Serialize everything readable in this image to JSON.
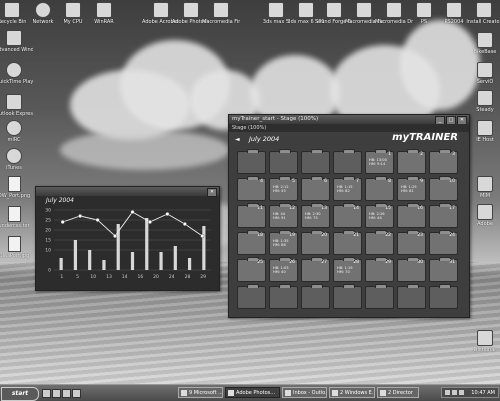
{
  "desktop": {
    "top_icons": [
      {
        "label": "Recycle Bin",
        "icon": "recycle-bin-icon"
      },
      {
        "label": "Network",
        "icon": "network-icon"
      },
      {
        "label": "My CPU",
        "icon": "computer-icon"
      },
      {
        "label": "WinRAR",
        "icon": "winrar-icon"
      },
      {
        "label": "Adobe Acrobat 4.0",
        "icon": "acrobat-icon"
      },
      {
        "label": "Adobe Photoshop",
        "icon": "photoshop-icon"
      },
      {
        "label": "Macromedia Fireworks 4.0",
        "icon": "fireworks-icon"
      },
      {
        "label": "3ds max 5",
        "icon": "3dsmax-icon"
      },
      {
        "label": "3ds max 6 SP1",
        "icon": "3dsmax-icon"
      },
      {
        "label": "Sound Forge 6.0",
        "icon": "soundforge-icon"
      },
      {
        "label": "Macromedia Flash MX",
        "icon": "flash-icon"
      },
      {
        "label": "Macromedia Dreamwea...",
        "icon": "dreamweaver-icon"
      },
      {
        "label": "PS",
        "icon": "app-icon"
      },
      {
        "label": "PS2004",
        "icon": "app-icon"
      },
      {
        "label": "Install Creator",
        "icon": "installer-icon"
      }
    ],
    "left_icons": [
      {
        "label": "Advanced WindowsM...",
        "icon": "app-icon"
      },
      {
        "label": "QuickTime Player",
        "icon": "quicktime-icon"
      },
      {
        "label": "Outlook Express",
        "icon": "outlook-icon"
      },
      {
        "label": "mIRC",
        "icon": "mirc-icon"
      },
      {
        "label": "iTunes",
        "icon": "itunes-icon"
      },
      {
        "label": "DW_Port.png",
        "icon": "image-file-icon"
      },
      {
        "label": "undercss.txt",
        "icon": "text-file-icon"
      },
      {
        "label": "DW_Port.jpg",
        "icon": "image-file-icon"
      }
    ],
    "right_icons": [
      {
        "label": "BikeBase",
        "icon": "app-icon"
      },
      {
        "label": "ServiO",
        "icon": "app-icon"
      },
      {
        "label": "Steady",
        "icon": "app-icon"
      },
      {
        "label": "IE Host",
        "icon": "ie-icon"
      },
      {
        "label": "MIM",
        "icon": "app-icon"
      },
      {
        "label": "Adobe",
        "icon": "app-icon"
      },
      {
        "label": "Dictionar",
        "icon": "app-icon"
      }
    ]
  },
  "chart_window": {
    "month_label": "July 2004"
  },
  "chart_data": {
    "type": "bar",
    "title": "July 2004",
    "categories": [
      "1",
      "2",
      "3",
      "4",
      "5",
      "6",
      "7",
      "8",
      "9",
      "10",
      "11",
      "12",
      "13",
      "14",
      "15",
      "16",
      "17",
      "18",
      "19",
      "20",
      "21",
      "22",
      "23",
      "24",
      "25",
      "26",
      "27",
      "28",
      "29",
      "30",
      "31"
    ],
    "x_tick_labels": [
      "1",
      "5",
      "10",
      "13",
      "14",
      "16",
      "20",
      "24",
      "28",
      "29"
    ],
    "ylim": [
      0,
      30
    ],
    "y_ticks": [
      "0",
      "10",
      "15",
      "20",
      "25",
      "30"
    ],
    "series": [
      {
        "values": [
          6,
          15,
          10,
          5,
          23,
          9,
          26,
          9,
          12,
          6,
          22
        ]
      },
      {
        "values": [
          24,
          27,
          25,
          17,
          29,
          24,
          28,
          23,
          17
        ]
      }
    ],
    "grid": true
  },
  "calendar_window": {
    "title": "myTrainer_start - Stage (100%)",
    "stage_label": "Stage (100%)",
    "month_label": "July 2004",
    "nav_prev": "◄",
    "brand": "myTRAINER",
    "days": [
      {
        "num": "",
        "note": ""
      },
      {
        "num": "",
        "note": ""
      },
      {
        "num": "",
        "note": ""
      },
      {
        "num": "",
        "note": ""
      },
      {
        "num": "1",
        "note": "HB: 13:00\nHM: 9:14"
      },
      {
        "num": "2",
        "note": ""
      },
      {
        "num": "3",
        "note": ""
      },
      {
        "num": "4",
        "note": ""
      },
      {
        "num": "5",
        "note": "HB: 2:12\nHM: 55"
      },
      {
        "num": "6",
        "note": ""
      },
      {
        "num": "7",
        "note": "HB: 1:15\nHM: 82"
      },
      {
        "num": "8",
        "note": ""
      },
      {
        "num": "9",
        "note": "HB: 1:29\nHM: 81"
      },
      {
        "num": "10",
        "note": ""
      },
      {
        "num": "11",
        "note": ""
      },
      {
        "num": "12",
        "note": "HB: 44\nHM: 91"
      },
      {
        "num": "13",
        "note": "HB: 2:30\nHM: 75"
      },
      {
        "num": "14",
        "note": ""
      },
      {
        "num": "15",
        "note": "HB: 2:26\nHM: 44"
      },
      {
        "num": "16",
        "note": ""
      },
      {
        "num": "17",
        "note": ""
      },
      {
        "num": "18",
        "note": ""
      },
      {
        "num": "19",
        "note": "HB: 1:35\nHM: 88"
      },
      {
        "num": "20",
        "note": ""
      },
      {
        "num": "21",
        "note": ""
      },
      {
        "num": "22",
        "note": ""
      },
      {
        "num": "23",
        "note": ""
      },
      {
        "num": "24",
        "note": ""
      },
      {
        "num": "25",
        "note": ""
      },
      {
        "num": "26",
        "note": "HB: 1:03\nHM: 40"
      },
      {
        "num": "27",
        "note": ""
      },
      {
        "num": "28",
        "note": "HB: 1:19\nHM: 70"
      },
      {
        "num": "29",
        "note": ""
      },
      {
        "num": "30",
        "note": ""
      },
      {
        "num": "31",
        "note": ""
      },
      {
        "num": "",
        "note": ""
      },
      {
        "num": "",
        "note": ""
      },
      {
        "num": "",
        "note": ""
      },
      {
        "num": "",
        "note": ""
      },
      {
        "num": "",
        "note": ""
      },
      {
        "num": "",
        "note": ""
      },
      {
        "num": "",
        "note": ""
      }
    ]
  },
  "taskbar": {
    "start_label": "start",
    "tasks": [
      {
        "label": "9 Microsoft ..."
      },
      {
        "label": "Adobe Photos..."
      },
      {
        "label": "Inbox - Outlo..."
      },
      {
        "label": "2 Windows E..."
      },
      {
        "label": "2 Director"
      }
    ],
    "clock": "10:47 AM"
  }
}
